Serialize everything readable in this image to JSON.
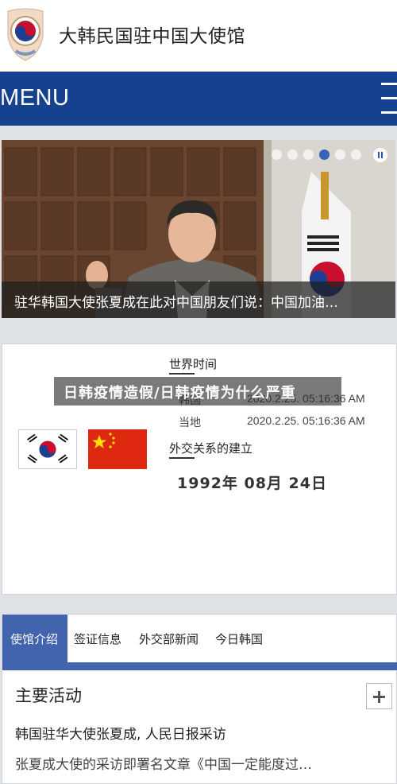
{
  "header": {
    "title": "大韩民国驻中国大使馆"
  },
  "menu": {
    "label": "MENU"
  },
  "slider": {
    "caption": "驻华韩国大使张夏成在此对中国朋友们说：中国加油…",
    "dot_count": 6,
    "active_dot": 3
  },
  "world_time": {
    "title": "世界时间",
    "korea_label": "韩国",
    "korea_value": "2020.2.25.  05:16:36 AM",
    "local_label": "当地",
    "local_value": "2020.2.25.  05:16:36 AM"
  },
  "diplomacy": {
    "title": "外交关系的建立",
    "date": "1992年 08月 24日"
  },
  "overlay": {
    "text": "日韩疫情造假/日韩疫情为什么严重"
  },
  "tabs": [
    {
      "label": "使馆介绍"
    },
    {
      "label": "签证信息"
    },
    {
      "label": "外交部新闻"
    },
    {
      "label": "今日韩国"
    }
  ],
  "activities": {
    "title": "主要活动",
    "news_title": "韩国驻华大使张夏成, 人民日报采访",
    "news_summary": "张夏成大使的采访即署名文章《中国一定能度过…"
  },
  "colors": {
    "brand_blue": "#15418e",
    "tab_blue": "#4263ad",
    "china_red": "#de2910"
  }
}
